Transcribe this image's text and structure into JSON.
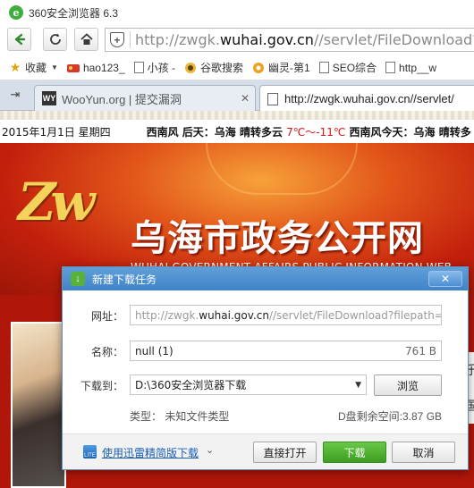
{
  "window": {
    "title": "360安全浏览器 6.3"
  },
  "nav": {
    "url_prefix": "http://zwgk.",
    "url_domain": "wuhai.gov.cn",
    "url_suffix": "//servlet/FileDownload?file"
  },
  "bookmarks": [
    {
      "label": "收藏"
    },
    {
      "label": "hao123_"
    },
    {
      "label": "小孩 -"
    },
    {
      "label": "谷歌搜索"
    },
    {
      "label": "幽灵-第1"
    },
    {
      "label": "SEO综合"
    },
    {
      "label": "http__w"
    }
  ],
  "tabs": [
    {
      "label": "WooYun.org | 提交漏洞",
      "icon_text": "WY"
    },
    {
      "label": "http://zwgk.wuhai.gov.cn//servlet/"
    }
  ],
  "page": {
    "date": "2015年1月1日 星期四",
    "weather_a": "西南风 后天：乌海 晴转多云 ",
    "temp": "7℃～-11℃",
    "weather_b": " 西南风今天：乌海 晴转多",
    "logo_text": "Zw",
    "banner_title": "乌海市政务公开网",
    "banner_subtitle": "WUHAI GOVERNMENT AFFAIRS PUBLIC INFORMATION WEB",
    "side_text": "乐国"
  },
  "dialog": {
    "title": "新建下载任务",
    "url_label": "网址：",
    "url_prefix": "http://zwgk.",
    "url_domain": "wuhai.gov.cn",
    "url_suffix": "//servlet/FileDownload?filepath=C",
    "name_label": "名称：",
    "file_name": "null (1)",
    "file_size": "761 B",
    "path_label": "下载到：",
    "path_value": "D:\\360安全浏览器下载",
    "browse_label": "浏览",
    "type_info": "类型： 未知文件类型",
    "space_info": "D盘剩余空间:3.87 GB",
    "thunder_link": "使用迅雷精简版下载",
    "open_label": "直接打开",
    "download_label": "下载",
    "cancel_label": "取消"
  },
  "colors": {
    "accent": "#3f83c9",
    "download_button": "#4aab2c",
    "banner_red": "#c3200c",
    "temp_red": "#dd1111"
  }
}
